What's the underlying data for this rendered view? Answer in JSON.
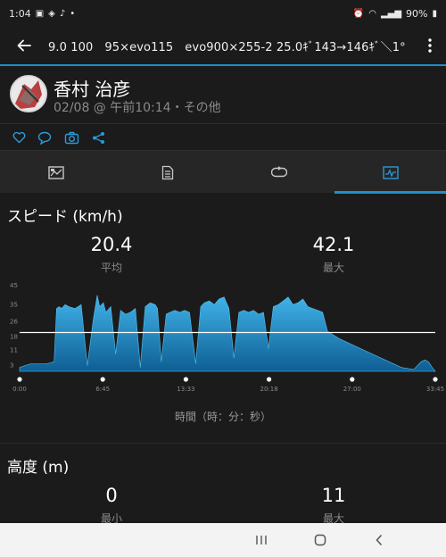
{
  "status_bar": {
    "time": "1:04",
    "battery": "90%"
  },
  "app_bar": {
    "title": "9.0 100　95×evo115　evo900×255-2 25.0ｷﾞ143→146ｷﾞ＼1℃"
  },
  "activity": {
    "user_name": "香村 治彦",
    "meta": "02/08 @ 午前10:14・その他"
  },
  "actions": [
    "heart-icon",
    "comment-icon",
    "camera-icon",
    "share-icon"
  ],
  "tabs": [
    {
      "icon": "overview-icon"
    },
    {
      "icon": "details-icon"
    },
    {
      "icon": "laps-icon"
    },
    {
      "icon": "charts-icon",
      "active": true
    }
  ],
  "speed_panel": {
    "title": "スピード (km/h)",
    "avg_value": "20.4",
    "avg_label": "平均",
    "max_value": "42.1",
    "max_label": "最大",
    "axis_caption": "時間（時：分：秒）"
  },
  "altitude_panel": {
    "title": "高度 (m)",
    "min_value": "0",
    "min_label": "最小",
    "max_value": "11",
    "max_label": "最大"
  },
  "colors": {
    "accent": "#1e8fc9",
    "area_top": "#41b4ea",
    "area_bottom": "#0e5f93",
    "background": "#1b1b1b"
  },
  "chart_data": {
    "type": "area",
    "title": "",
    "xlabel": "時間（時：分：秒）",
    "ylabel": "",
    "x_ticks": [
      "0:00",
      "6:45",
      "13:33",
      "20:18",
      "27:00",
      "33:45"
    ],
    "y_ticks": [
      3,
      11,
      18,
      26,
      35,
      45
    ],
    "ylim": [
      0,
      45
    ],
    "xlim_minutes": [
      0,
      33.75
    ],
    "average_line": 20.4,
    "series": [
      {
        "x_minutes": [
          0,
          0.4,
          0.9,
          1.5,
          2.2,
          2.8,
          3.0,
          3.2,
          3.4,
          3.7,
          4.0,
          4.5,
          5.0,
          5.5,
          6.0,
          6.3,
          6.5,
          6.8,
          7.0,
          7.4,
          7.8,
          8.2,
          8.6,
          9.0,
          9.4,
          9.8,
          10.2,
          10.6,
          11.0,
          11.2,
          11.5,
          11.9,
          12.2,
          12.6,
          13.0,
          13.4,
          13.8,
          14.3,
          14.7,
          15.0,
          15.4,
          15.8,
          16.2,
          16.6,
          17.0,
          17.4,
          17.8,
          18.2,
          18.6,
          19.0,
          19.4,
          19.8,
          20.2,
          20.6,
          21.0,
          21.4,
          21.8,
          22.2,
          22.6,
          23.0,
          23.4,
          23.8,
          24.2,
          24.6,
          25.0,
          26.0,
          27.0,
          28.0,
          29.0,
          30.0,
          31.0,
          32.0,
          32.6,
          32.9,
          33.2,
          33.5,
          33.75
        ],
        "values": [
          2,
          3,
          4,
          4,
          4,
          5,
          33,
          34,
          33,
          35,
          34,
          33,
          35,
          3,
          28,
          40,
          34,
          36,
          31,
          34,
          9,
          32,
          30,
          31,
          33,
          2,
          34,
          36,
          35,
          33,
          5,
          30,
          31,
          32,
          31,
          32,
          31,
          4,
          34,
          36,
          37,
          35,
          38,
          39,
          33,
          7,
          31,
          32,
          31,
          32,
          30,
          31,
          12,
          34,
          35,
          37,
          39,
          35,
          36,
          38,
          34,
          33,
          32,
          31,
          21,
          17,
          14,
          11,
          8,
          5,
          2,
          1,
          5,
          6,
          5,
          2,
          0
        ]
      }
    ]
  }
}
